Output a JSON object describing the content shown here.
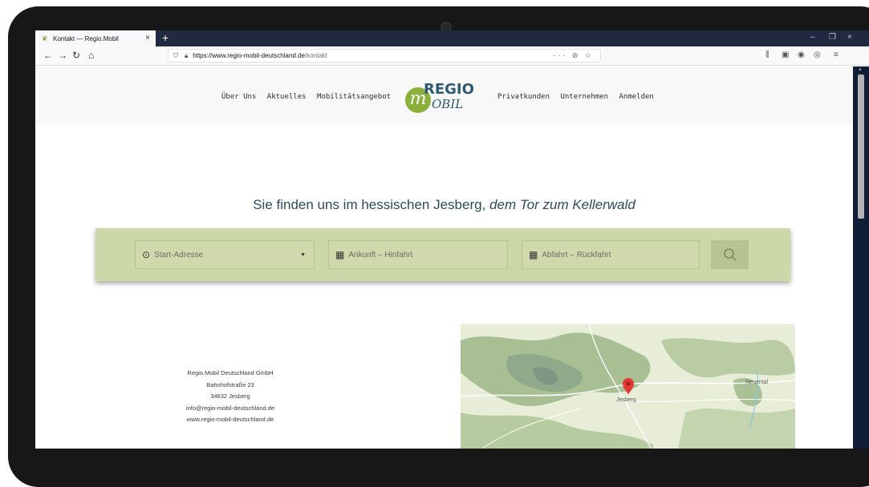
{
  "browser": {
    "tab_title": "Kontakt — Regio.Mobil",
    "tab_close": "×",
    "new_tab": "+",
    "url_host": "https://www.regio-mobil-deutschland.de",
    "url_path": "/kontakt",
    "url_actions": "··· ⊘ ☆",
    "window_minimize": "–",
    "window_restore": "❐",
    "window_close": "×"
  },
  "site": {
    "logo_top": "REGIO",
    "logo_bottom": "OBIL",
    "logo_m": "m",
    "menu_left": [
      "Über Uns",
      "Aktuelles",
      "Mobilitätsangebot"
    ],
    "menu_right": [
      "Privatkunden",
      "Unternehmen",
      "Anmelden"
    ]
  },
  "main": {
    "headline_plain": "Sie finden uns im hessischen Jesberg,",
    "headline_italic": "dem Tor zum Kellerwald"
  },
  "search": {
    "start_placeholder": "Start-Adresse",
    "arrival_placeholder": "Ankunft – Hinfahrt",
    "departure_placeholder": "Abfahrt – Rückfahrt"
  },
  "address": {
    "company": "Regio.Mobil Deutschland GmbH",
    "street": "Bahnhofstraße 23",
    "city": "34632 Jesberg",
    "email": "info@regio-mobil-deutschland.de",
    "web": "www.regio-mobil-deutschland.de"
  },
  "map": {
    "labels": [
      "Jesberg",
      "Neuental"
    ]
  },
  "colors": {
    "accent_green": "#8aaf3a",
    "brand_blue": "#2d5a74",
    "search_panel": "#cdd8a9"
  }
}
